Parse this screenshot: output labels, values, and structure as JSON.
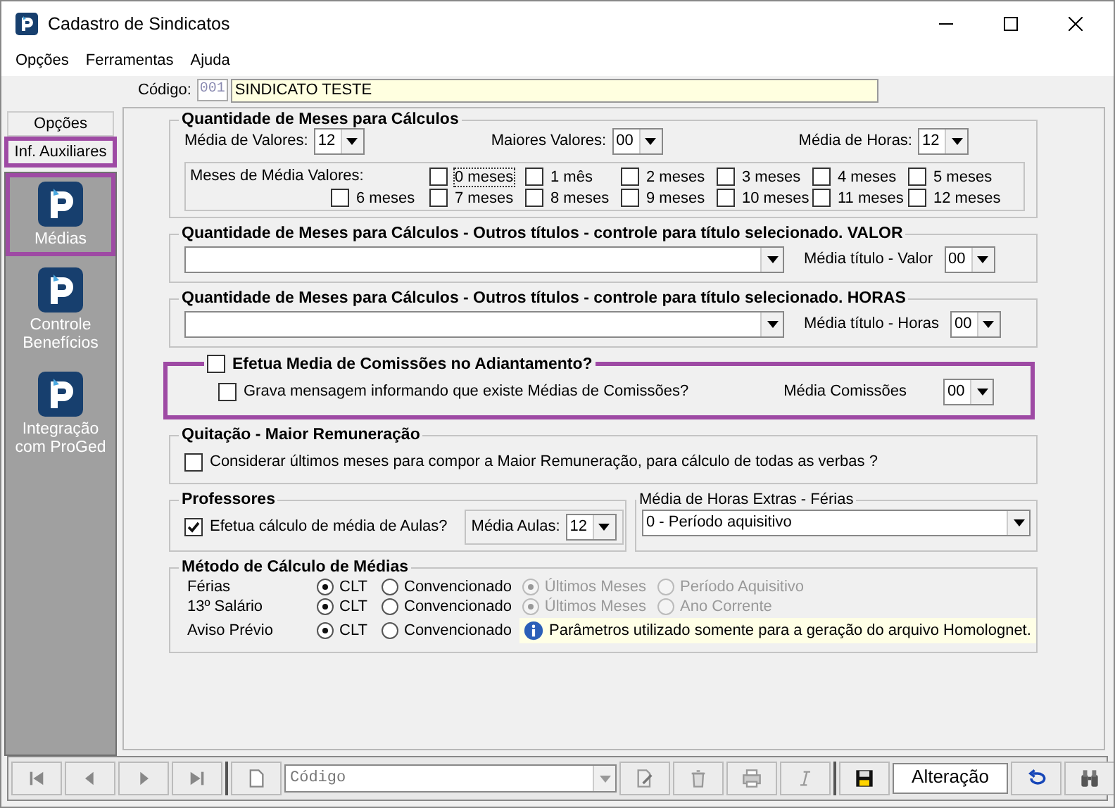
{
  "window": {
    "title": "Cadastro de Sindicatos"
  },
  "menu": [
    {
      "label": "Opções"
    },
    {
      "label": "Ferramentas"
    },
    {
      "label": "Ajuda"
    }
  ],
  "record": {
    "label": "Código:",
    "code": "001",
    "name": "SINDICATO TESTE"
  },
  "side_tabs": [
    {
      "label": "Opções",
      "highlighted": false
    },
    {
      "label": "Inf. Auxiliares",
      "highlighted": true
    }
  ],
  "side_items": [
    {
      "label": "Médias",
      "highlighted": true
    },
    {
      "label": "Controle Benefícios",
      "highlighted": false
    },
    {
      "label": "Integração com ProGed",
      "highlighted": false
    }
  ],
  "months_group": {
    "title": "Quantidade de Meses para Cálculos",
    "selects": [
      {
        "label": "Média de Valores:",
        "value": "12"
      },
      {
        "label": "Maiores Valores:",
        "value": "00"
      },
      {
        "label": "Média de Horas:",
        "value": "12"
      }
    ],
    "months_label": "Meses de Média Valores:",
    "months": [
      {
        "label": "0 meses",
        "checked": false,
        "focused": true
      },
      {
        "label": "1 mês",
        "checked": false,
        "focused": false
      },
      {
        "label": "2 meses",
        "checked": false,
        "focused": false
      },
      {
        "label": "3 meses",
        "checked": false,
        "focused": false
      },
      {
        "label": "4 meses",
        "checked": false,
        "focused": false
      },
      {
        "label": "5 meses",
        "checked": false,
        "focused": false
      },
      {
        "label": "6 meses",
        "checked": false,
        "focused": false
      },
      {
        "label": "7 meses",
        "checked": false,
        "focused": false
      },
      {
        "label": "8 meses",
        "checked": false,
        "focused": false
      },
      {
        "label": "9 meses",
        "checked": false,
        "focused": false
      },
      {
        "label": "10 meses",
        "checked": false,
        "focused": false
      },
      {
        "label": "11 meses",
        "checked": false,
        "focused": false
      },
      {
        "label": "12 meses",
        "checked": false,
        "focused": false
      }
    ]
  },
  "title_groups": [
    {
      "title": "Quantidade de Meses para Cálculos - Outros títulos - controle para título selecionado. VALOR",
      "label": "Média título - Valor",
      "value": "00"
    },
    {
      "title": "Quantidade de Meses para Cálculos - Outros títulos - controle para título selecionado. HORAS",
      "label": "Média título - Horas",
      "value": "00"
    }
  ],
  "commissions": {
    "title": "Efetua Media de Comissões no Adiantamento?",
    "checked": false,
    "highlighted": true,
    "message_option": {
      "label": "Grava mensagem informando que existe Médias de Comissões?",
      "checked": false
    },
    "select": {
      "label": "Média Comissões",
      "value": "00"
    }
  },
  "settlement": {
    "title": "Quitação - Maior Remuneração",
    "option": {
      "label": "Considerar últimos meses para compor a Maior Remuneração, para cálculo de todas as verbas ?",
      "checked": false
    }
  },
  "teachers": {
    "title": "Professores",
    "option": {
      "label": "Efetua cálculo de média de Aulas?",
      "checked": true
    },
    "select": {
      "label": "Média Aulas:",
      "value": "12"
    }
  },
  "overtime": {
    "title": "Média de Horas Extras - Férias",
    "value": "0 - Período aquisitivo"
  },
  "method": {
    "title": "Método de Cálculo de Médias",
    "rows": [
      {
        "label": "Férias",
        "options": [
          {
            "label": "CLT",
            "selected": true
          },
          {
            "label": "Convencionado",
            "selected": false
          }
        ],
        "extra": {
          "disabled": true,
          "options": [
            {
              "label": "Últimos Meses",
              "selected": true
            },
            {
              "label": "Período Aquisitivo",
              "selected": false
            }
          ]
        }
      },
      {
        "label": "13º Salário",
        "options": [
          {
            "label": "CLT",
            "selected": true
          },
          {
            "label": "Convencionado",
            "selected": false
          }
        ],
        "extra": {
          "disabled": true,
          "options": [
            {
              "label": "Últimos Meses",
              "selected": true
            },
            {
              "label": "Ano Corrente",
              "selected": false
            }
          ]
        }
      },
      {
        "label": "Aviso Prévio",
        "options": [
          {
            "label": "CLT",
            "selected": true
          },
          {
            "label": "Convencionado",
            "selected": false
          }
        ]
      }
    ],
    "note": "Parâmetros utilizado somente para a geração do arquivo Homolognet."
  },
  "toolbar": {
    "search": {
      "value": "Código",
      "disabled": true
    },
    "status": "Alteração"
  }
}
